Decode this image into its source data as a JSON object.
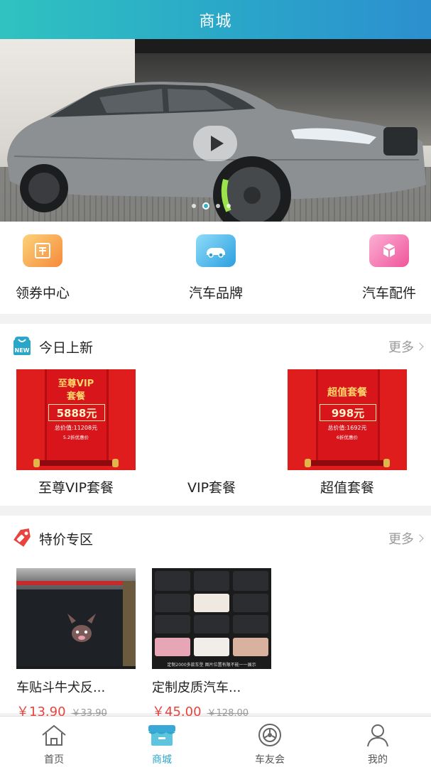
{
  "header": {
    "title": "商城"
  },
  "banner": {
    "slides": 4,
    "active_slide": 2
  },
  "categories": [
    {
      "label": "领券中心",
      "icon": "coupon-icon",
      "color": "#f8a64a"
    },
    {
      "label": "汽车品牌",
      "icon": "car-brand-icon",
      "color": "#38b3ea"
    },
    {
      "label": "汽车配件",
      "icon": "parts-icon",
      "color": "#f46fb0"
    }
  ],
  "new_today": {
    "title": "今日上新",
    "more": "更多",
    "icon_badge": "NEW",
    "items": [
      {
        "name": "至尊VIP套餐",
        "poster_title_1": "至尊VIP",
        "poster_title_2": "套餐",
        "poster_price": "5888元",
        "poster_total": "总价值:11208元",
        "poster_discount": "5.2折优惠价"
      },
      {
        "name": "VIP套餐"
      },
      {
        "name": "超值套餐",
        "poster_title_1": "超值套餐",
        "poster_title_2": "",
        "poster_price": "998元",
        "poster_total": "总价值:1692元",
        "poster_discount": "6折优惠价"
      }
    ]
  },
  "special": {
    "title": "特价专区",
    "more": "更多",
    "items": [
      {
        "name": "车贴斗牛犬反...",
        "price": "￥13.90",
        "old_price": "￥33.90"
      },
      {
        "name": "定制皮质汽车...",
        "price": "￥45.00",
        "old_price": "￥128.00",
        "caption": "定制2000多款车型 图片位置有限不能一一展示"
      }
    ]
  },
  "tabbar": {
    "tabs": [
      {
        "label": "首页",
        "icon": "home-icon"
      },
      {
        "label": "商城",
        "icon": "shop-icon",
        "active": true
      },
      {
        "label": "车友会",
        "icon": "wheel-icon"
      },
      {
        "label": "我的",
        "icon": "user-icon"
      }
    ]
  },
  "colors": {
    "accent": "#2aa6c9",
    "price": "#e8433e",
    "poster_red": "#e01d1d"
  }
}
